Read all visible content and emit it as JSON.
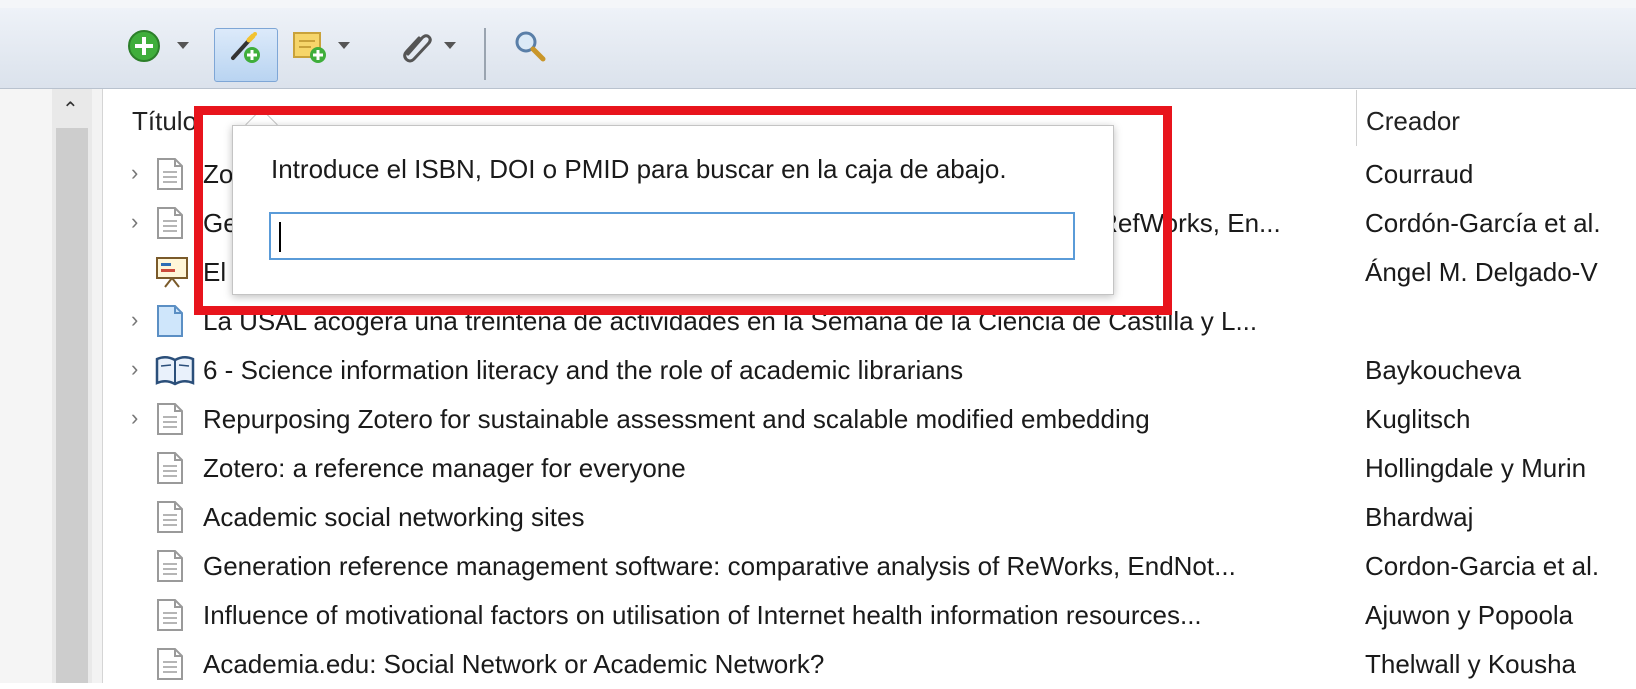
{
  "toolbar": {
    "buttons": [
      {
        "icon": "new-item-icon",
        "has_dropdown": true
      },
      {
        "icon": "add-by-identifier-icon",
        "active": true
      },
      {
        "icon": "new-note-icon",
        "has_dropdown": true
      },
      {
        "icon": "attachment-icon",
        "has_dropdown": true
      },
      {
        "icon": "search-icon"
      }
    ]
  },
  "columns": {
    "title": "Título",
    "creator": "Creador"
  },
  "rows": [
    {
      "title": "Zo",
      "creator": "Courraud",
      "icon": "document-icon",
      "expandable": true
    },
    {
      "title": "Ge",
      "title_right": "<i>RefWorks, En...",
      "creator": "Cordón-García et al.",
      "icon": "document-icon",
      "expandable": true
    },
    {
      "title": "El",
      "creator": "Ángel M. Delgado-V",
      "icon": "presentation-icon",
      "expandable": false
    },
    {
      "title": "La USAL acogerá una treintena de actividades en la Semana de la Ciencia de Castilla y L...",
      "creator": "",
      "icon": "webpage-icon",
      "expandable": true
    },
    {
      "title": "6 - Science information literacy and the role of academic librarians",
      "creator": "Baykoucheva",
      "icon": "book-icon",
      "expandable": true
    },
    {
      "title": "Repurposing Zotero for sustainable assessment and scalable modified embedding",
      "creator": "Kuglitsch",
      "icon": "document-icon",
      "expandable": true
    },
    {
      "title": "Zotero: a reference manager for everyone",
      "creator": "Hollingdale y Murin",
      "icon": "document-icon",
      "expandable": false
    },
    {
      "title": "Academic social networking sites",
      "creator": "Bhardwaj",
      "icon": "document-icon",
      "expandable": false
    },
    {
      "title": "Generation reference management software: comparative analysis of ReWorks, EndNot...",
      "creator": "Cordon-Garcia et al.",
      "icon": "document-icon",
      "expandable": false
    },
    {
      "title": "Influence of motivational factors on utilisation of Internet health information resources...",
      "creator": "Ajuwon y Popoola",
      "icon": "document-icon",
      "expandable": false
    },
    {
      "title": "Academia.edu: Social Network or Academic Network?",
      "creator": "Thelwall y Kousha",
      "icon": "document-icon",
      "expandable": false
    }
  ],
  "popup": {
    "label": "Introduce el ISBN, DOI o PMID para buscar en la caja de abajo.",
    "input_value": "",
    "input_placeholder": ""
  },
  "colors": {
    "highlight": "#e8141c",
    "input_border": "#5a9bd8"
  }
}
